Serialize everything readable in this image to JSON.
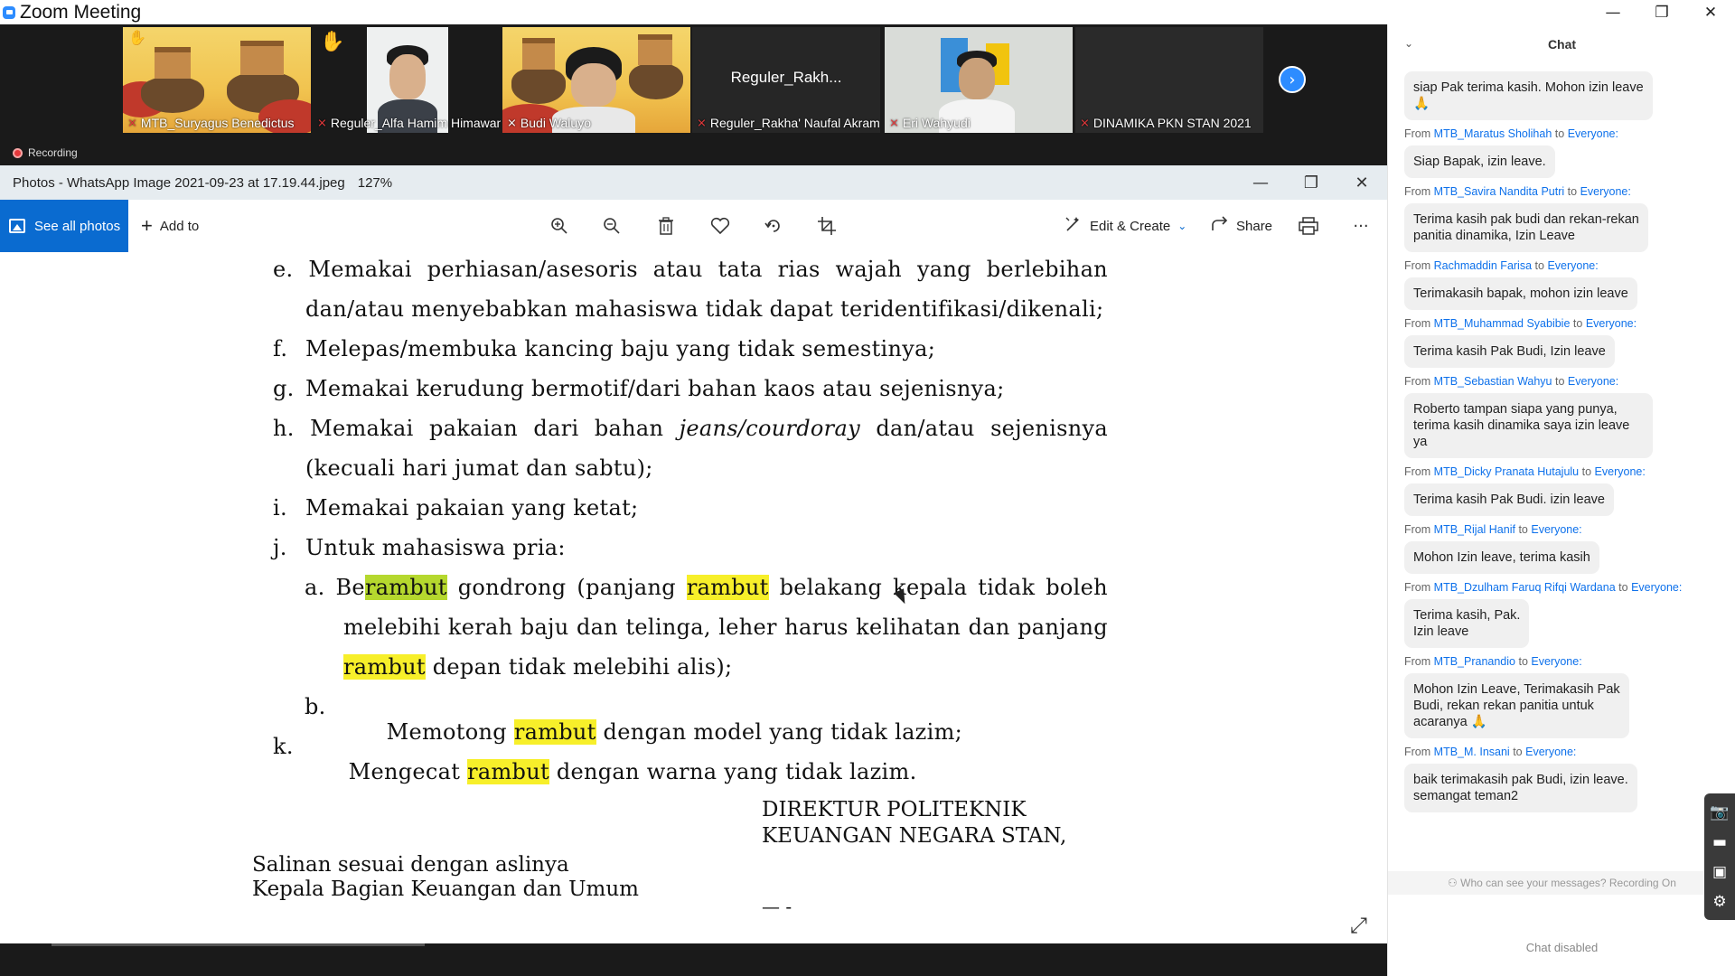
{
  "zoom": {
    "window_title": "Zoom Meeting",
    "controls": {
      "minimize": "—",
      "restore": "❐",
      "close": "✕"
    }
  },
  "strip": {
    "participants": [
      {
        "name": "MTB_Suryagus Benedictus",
        "type": "scene"
      },
      {
        "name": "Reguler_Alfa Hamim Himawan",
        "type": "person"
      },
      {
        "name": "Budi Waluyo",
        "type": "scene-person",
        "active": true
      },
      {
        "name": "Reguler_Rakha' Naufal Akram",
        "center_name": "Reguler_Rakh...",
        "type": "name-only"
      },
      {
        "name": "Eri Wahyudi",
        "type": "person-light"
      },
      {
        "name": "DINAMIKA PKN STAN 2021",
        "type": "name-only-dark"
      }
    ],
    "hand_icon": "✋",
    "recording_label": "Recording"
  },
  "photos": {
    "title": "Photos - WhatsApp Image 2021-09-23 at 17.19.44.jpeg",
    "zoom_level": "127%",
    "controls": {
      "minimize": "—",
      "restore": "❐",
      "close": "✕"
    },
    "toolbar": {
      "see_all": "See all photos",
      "add_to": "Add to",
      "edit_create": "Edit & Create",
      "share": "Share",
      "more": "···"
    }
  },
  "document": {
    "lines": {
      "e1": [
        "e.",
        "Memakai",
        "perhiasan/asesoris",
        "atau",
        "tata",
        "rias",
        "wajah",
        "yang",
        "berlebihan"
      ],
      "e2": "dan/atau menyebabkan mahasiswa tidak dapat teridentifikasi/dikenali;",
      "f_letter": "f.",
      "f_text": "Melepas/membuka kancing baju yang tidak semestinya;",
      "g_letter": "g.",
      "g_text": "Memakai kerudung bermotif/dari bahan kaos atau sejenisnya;",
      "h1": [
        "h.",
        "Memakai",
        "pakaian",
        "dari",
        "bahan",
        "jeans/courdoray",
        "dan/atau",
        "sejenisnya"
      ],
      "h2": "(kecuali hari jumat dan sabtu);",
      "i_letter": "i.",
      "i_text": "Memakai pakaian yang ketat;",
      "j_letter": "j.",
      "j_text": "Untuk mahasiswa pria:",
      "a1": [
        "a.",
        "Be",
        "rambut",
        "gondrong",
        "(panjang",
        "rambut",
        "belakang",
        "kepala",
        "tidak",
        "boleh"
      ],
      "a2": [
        "melebihi",
        "kerah",
        "baju",
        "dan",
        "telinga,",
        "leher",
        "harus",
        "kelihatan",
        "dan",
        "panjang"
      ],
      "a3_hl": "rambut",
      "a3_rest": " depan tidak melebihi alis);",
      "b_letter": "b.",
      "b_pre": "Memotong ",
      "b_hl": "rambut",
      "b_post": " dengan model yang tidak lazim;",
      "k_letter": "k.",
      "k_pre": "Mengecat ",
      "k_hl": "rambut",
      "k_post": " dengan warna yang tidak lazim."
    },
    "signature": {
      "director_line1": "DIREKTUR POLITEKNIK",
      "director_line2": "KEUANGAN NEGARA STAN,",
      "copy_line1": "Salinan sesuai dengan aslinya",
      "copy_line2": "Kepala Bagian Keuangan dan Umum",
      "dash": "— -"
    },
    "highlight_color": "#f7ef2a"
  },
  "chat": {
    "title": "Chat",
    "from_word": "From",
    "to_word": "to",
    "first_message": "siap Pak terima kasih. Mohon izin leave\n🙏",
    "messages": [
      {
        "sender": "MTB_Maratus Sholihah",
        "recipient": "Everyone:",
        "text": "Siap Bapak, izin leave."
      },
      {
        "sender": "MTB_Savira Nandita Putri",
        "recipient": "Everyone:",
        "text": "Terima kasih pak budi dan rekan-rekan\npanitia dinamika, Izin Leave"
      },
      {
        "sender": "Rachmaddin Farisa",
        "recipient": "Everyone:",
        "text": "Terimakasih bapak, mohon izin leave"
      },
      {
        "sender": "MTB_Muhammad Syabibie",
        "recipient": "Everyone:",
        "text": "Terima kasih Pak Budi, Izin leave"
      },
      {
        "sender": "MTB_Sebastian Wahyu",
        "recipient": "Everyone:",
        "text": "Roberto tampan siapa yang punya,\nterima kasih dinamika saya izin leave ya"
      },
      {
        "sender": "MTB_Dicky Pranata Hutajulu",
        "recipient": "Everyone:",
        "text": "Terima kasih Pak Budi. izin leave"
      },
      {
        "sender": "MTB_Rijal Hanif",
        "recipient": "Everyone:",
        "text": "Mohon Izin leave, terima kasih"
      },
      {
        "sender": "MTB_Dzulham Faruq Rifqi Wardana",
        "recipient": "Everyone:",
        "text": "Terima kasih, Pak.\nIzin leave"
      },
      {
        "sender": "MTB_Pranandio",
        "recipient": "Everyone:",
        "text": "Mohon Izin Leave, Terimakasih Pak\nBudi, rekan rekan panitia untuk\nacaranya 🙏"
      },
      {
        "sender": "MTB_M. Insani",
        "recipient": "Everyone:",
        "text": "baik terimakasih pak Budi, izin leave.\nsemangat teman2"
      }
    ],
    "privacy_note": "Who can see your messages? Recording On",
    "disabled_note": "Chat disabled"
  }
}
